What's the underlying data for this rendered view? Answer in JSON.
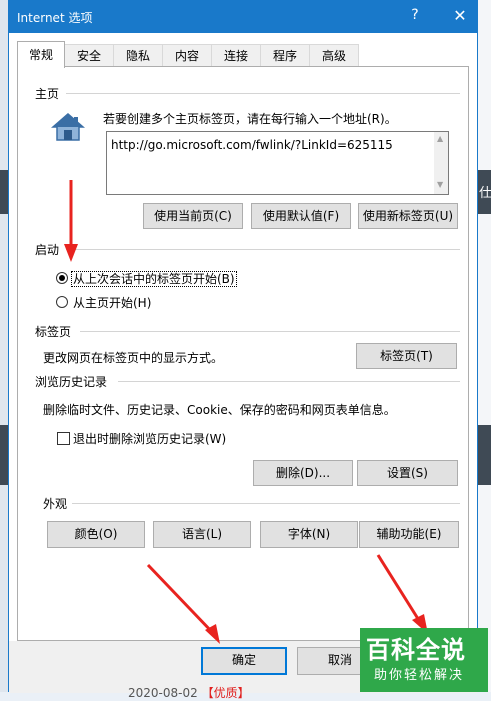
{
  "window": {
    "title": "Internet 选项",
    "help_glyph": "?",
    "close_glyph": "✕"
  },
  "tabs": [
    {
      "label": "常规",
      "active": true
    },
    {
      "label": "安全"
    },
    {
      "label": "隐私"
    },
    {
      "label": "内容"
    },
    {
      "label": "连接"
    },
    {
      "label": "程序"
    },
    {
      "label": "高级"
    }
  ],
  "homepage": {
    "group_title": "主页",
    "instruction": "若要创建多个主页标签页，请在每行输入一个地址(R)。",
    "url": "http://go.microsoft.com/fwlink/?LinkId=625115",
    "use_current": "使用当前页(C)",
    "use_default": "使用默认值(F)",
    "use_new_tab": "使用新标签页(U)"
  },
  "startup": {
    "group_title": "启动",
    "option_last_session": "从上次会话中的标签页开始(B)",
    "option_homepage": "从主页开始(H)",
    "selected": "option_last_session"
  },
  "tabs_section": {
    "group_title": "标签页",
    "description": "更改网页在标签页中的显示方式。",
    "button": "标签页(T)"
  },
  "history": {
    "group_title": "浏览历史记录",
    "description": "删除临时文件、历史记录、Cookie、保存的密码和网页表单信息。",
    "checkbox_label": "退出时删除浏览历史记录(W)",
    "checkbox_checked": false,
    "delete_button": "删除(D)...",
    "settings_button": "设置(S)"
  },
  "appearance": {
    "group_title": "外观",
    "colors": "颜色(O)",
    "languages": "语言(L)",
    "fonts": "字体(N)",
    "accessibility": "辅助功能(E)"
  },
  "footer": {
    "ok": "确定",
    "cancel": "取消"
  },
  "watermark": {
    "title": "百科全说",
    "subtitle": "助你轻松解决"
  },
  "background": {
    "date": "2020-08-02",
    "tag": "【优质】",
    "right_glyph": "仕"
  },
  "colors": {
    "title_bar": "#1979ca",
    "arrow": "#e8231f",
    "watermark": "#2fa84a"
  },
  "icons": {
    "homepage": "house-icon",
    "help": "question-icon",
    "close": "close-icon"
  }
}
